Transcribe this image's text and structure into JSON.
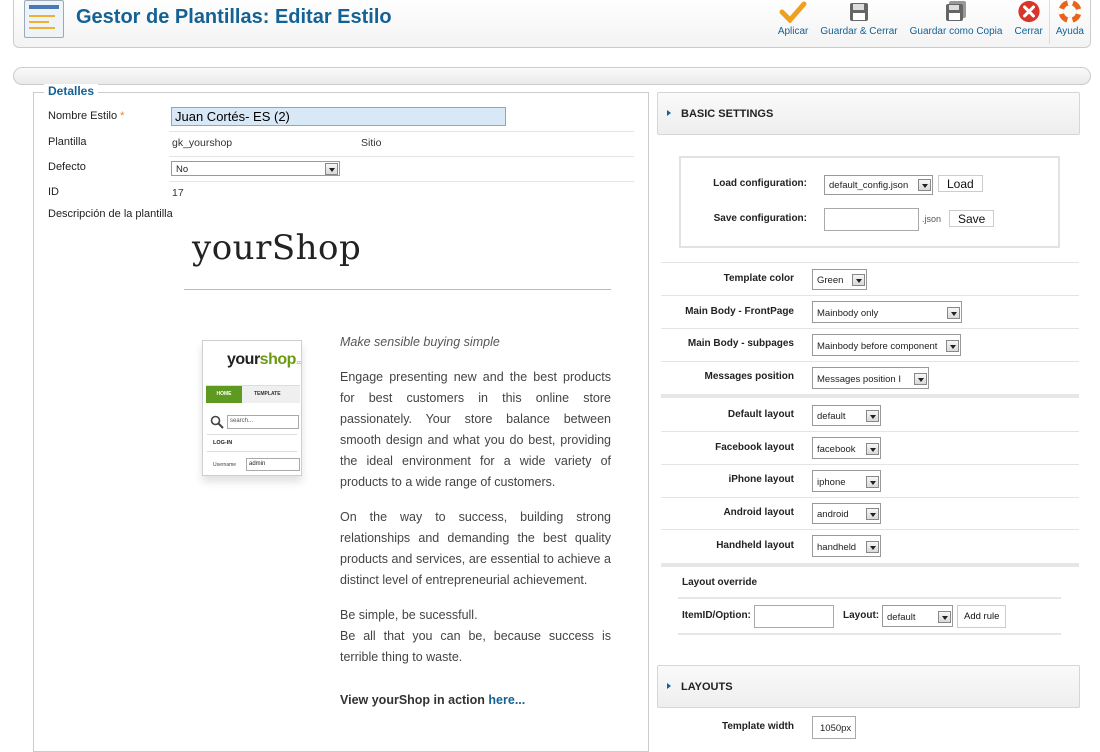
{
  "header": {
    "title": "Gestor de Plantillas: Editar Estilo"
  },
  "toolbar": {
    "apply": "Aplicar",
    "save_close": "Guardar & Cerrar",
    "save_copy": "Guardar como Copia",
    "close": "Cerrar",
    "help": "Ayuda"
  },
  "details": {
    "legend": "Detalles",
    "style_name_label": "Nombre Estilo",
    "required_mark": "*",
    "style_name_value": "Juan Cortés- ES (2)",
    "template_label": "Plantilla",
    "template_value": "gk_yourshop",
    "site_value": "Sitio",
    "default_label": "Defecto",
    "default_value": "No",
    "id_label": "ID",
    "id_value": "17",
    "desc_label": "Descripción de la plantilla"
  },
  "preview": {
    "brand": "yourShop",
    "logo_a": "your",
    "logo_b": "shop",
    "logo_c": ".cc",
    "home_tab": "HOME",
    "template_tab": "TEMPLATE",
    "search_placeholder": "search...",
    "login": "LOG-IN",
    "username_label": "Username",
    "username_value": "admin",
    "tagline": "Make sensible buying simple",
    "para1": "Engage presenting new and the best products for best customers in this online store passionately. Your store balance between smooth design and what you do best, providing the ideal environment for a wide variety of products to a wide range of customers.",
    "para2": "On the way to success, building strong relationships and demanding the best quality products and services, are essential to achieve a distinct level of entrepreneurial achievement.",
    "para3a": "Be simple, be sucessfull.",
    "para3b": "Be all that you can be, because success is terrible thing to waste.",
    "view_text": "View yourShop in action",
    "view_link": "here..."
  },
  "basic": {
    "title": "BASIC SETTINGS",
    "load_label": "Load configuration:",
    "load_value": "default_config.json",
    "load_btn": "Load",
    "save_label": "Save configuration:",
    "save_ext": ".json",
    "save_btn": "Save",
    "color_label": "Template color",
    "color_value": "Green",
    "mb_front_label": "Main Body - FrontPage",
    "mb_front_value": "Mainbody only",
    "mb_sub_label": "Main Body - subpages",
    "mb_sub_value": "Mainbody before component",
    "msg_label": "Messages position",
    "msg_value": "Messages position I",
    "def_layout_label": "Default layout",
    "def_layout_value": "default",
    "fb_label": "Facebook layout",
    "fb_value": "facebook",
    "iphone_label": "iPhone layout",
    "iphone_value": "iphone",
    "android_label": "Android layout",
    "android_value": "android",
    "handheld_label": "Handheld layout",
    "handheld_value": "handheld",
    "override_title": "Layout override",
    "itemid_label": "ItemID/Option:",
    "layout_label": "Layout:",
    "layout_value": "default",
    "add_rule": "Add rule"
  },
  "layouts": {
    "title": "LAYOUTS",
    "width_label": "Template width",
    "width_value": "1050px"
  }
}
